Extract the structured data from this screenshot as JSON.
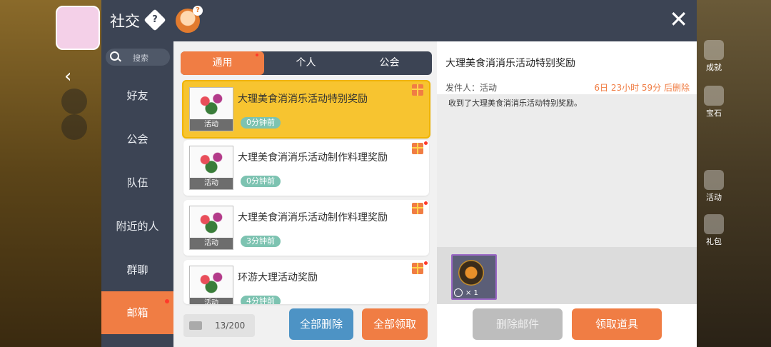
{
  "header": {
    "title": "社交",
    "help_glyph": "?",
    "close_glyph": "✕"
  },
  "nav": {
    "search_placeholder": "搜索",
    "items": [
      {
        "label": "好友"
      },
      {
        "label": "公会"
      },
      {
        "label": "队伍"
      },
      {
        "label": "附近的人"
      },
      {
        "label": "群聊"
      },
      {
        "label": "邮箱",
        "active": true
      }
    ]
  },
  "tabs": [
    {
      "label": "通用",
      "active": true
    },
    {
      "label": "个人"
    },
    {
      "label": "公会"
    }
  ],
  "mails": [
    {
      "title": "大理美食消消乐活动特别奖励",
      "time": "0分钟前",
      "thumb_caption": "活动",
      "selected": true
    },
    {
      "title": "大理美食消消乐活动制作料理奖励",
      "time": "0分钟前",
      "thumb_caption": "活动"
    },
    {
      "title": "大理美食消消乐活动制作料理奖励",
      "time": "3分钟前",
      "thumb_caption": "活动"
    },
    {
      "title": "环游大理活动奖励",
      "time": "4分钟前",
      "thumb_caption": "活动"
    }
  ],
  "footer": {
    "count": "13/200",
    "delete_all": "全部删除",
    "claim_all": "全部领取"
  },
  "detail": {
    "title": "大理美食消消乐活动特别奖励",
    "sender": "发件人：活动",
    "expire": "6日 23小时 59分 后删除",
    "body": "收到了大理美食消消乐活动特别奖励。",
    "attachment_qty": "× 1",
    "delete_button": "删除邮件",
    "claim_button": "领取道具"
  },
  "game_hud": {
    "right_icons": [
      "成就",
      "宝石",
      "活动",
      "礼包"
    ]
  },
  "colors": {
    "accent": "#f07d44",
    "dark": "#3c4454",
    "selected": "#f7c430",
    "time_badge": "#7dc3b1",
    "blue_button": "#4d93c5"
  }
}
